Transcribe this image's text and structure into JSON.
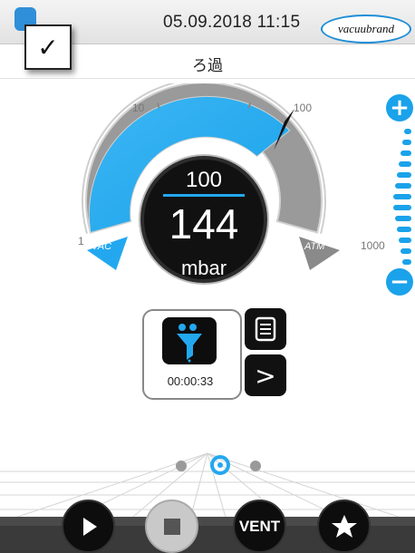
{
  "header": {
    "datetime": "05.09.2018  11:15",
    "logo_text": "vacuubrand",
    "check_icon": "check-icon",
    "subtitle": "ろ過"
  },
  "gauge": {
    "scale_labels": {
      "min": "1",
      "mid": "10",
      "high": "100",
      "max": "1000"
    },
    "target": "100",
    "pressure": "144",
    "unit": "mbar",
    "vac_label": "VAC",
    "atm_label": "ATM",
    "colors": {
      "vacuum_fill": "#23a8f0",
      "atm_fill": "#9a9a9a",
      "needle": "#111111",
      "accent": "#1aa2ea"
    }
  },
  "method": {
    "icon": "filter-funnel-icon",
    "timer": "00:00:33"
  },
  "controls": {
    "vent_label": "VENT",
    "play_icon": "play-icon",
    "stop_icon": "stop-icon",
    "favorite_icon": "star-icon"
  },
  "pager": {
    "active_index": 1,
    "count": 3
  }
}
